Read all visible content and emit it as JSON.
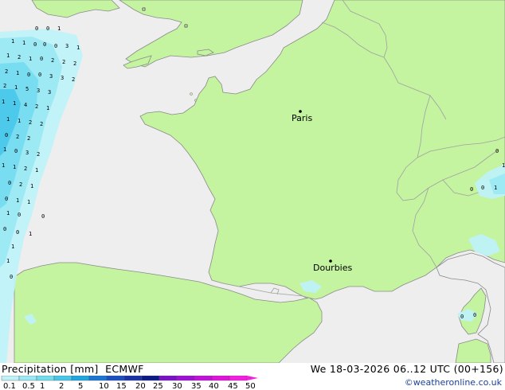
{
  "header": {
    "title": "Precipitation [mm]",
    "model": "ECMWF",
    "validity": "We 18-03-2026 06..12 UTC (00+156)",
    "credit": "©weatheronline.co.uk"
  },
  "cities": [
    {
      "name": "Paris"
    },
    {
      "name": "Dourbies"
    }
  ],
  "legend": {
    "ticks": [
      "0.1",
      "0.5",
      "1",
      "2",
      "5",
      "10",
      "15",
      "20",
      "25",
      "30",
      "35",
      "40",
      "45",
      "50"
    ],
    "colors": [
      "#bff2f8",
      "#9be8f3",
      "#74dcef",
      "#48c6ea",
      "#1fa6e0",
      "#1a75d6",
      "#1c4fc4",
      "#1b33a8",
      "#0b1b88",
      "#7a11c9",
      "#a00fd6",
      "#c110d9",
      "#e012dc",
      "#f51ee3"
    ]
  },
  "colors": {
    "sea": "#eeeeee",
    "land": "#c4f4a0",
    "border": "#a0a0a0",
    "coast": "#8a8a8a"
  },
  "precip_values": [
    "0",
    "0",
    "1",
    "1",
    "1",
    "0",
    "0",
    "0",
    "3",
    "1",
    "1",
    "2",
    "1",
    "0",
    "2",
    "2",
    "2",
    "2",
    "1",
    "0",
    "0",
    "3",
    "3",
    "2",
    "2",
    "1",
    "5",
    "3",
    "3",
    "1",
    "1",
    "4",
    "2",
    "1",
    "1",
    "1",
    "2",
    "2",
    "0",
    "2",
    "2",
    "1",
    "0",
    "3",
    "2",
    "1",
    "1",
    "2",
    "1",
    "0",
    "2",
    "1",
    "0",
    "1",
    "1",
    "0",
    "1",
    "0",
    "0",
    "0",
    "1",
    "1",
    "1",
    "0",
    "0",
    "0",
    "1",
    "0",
    "0",
    "0",
    "1"
  ]
}
